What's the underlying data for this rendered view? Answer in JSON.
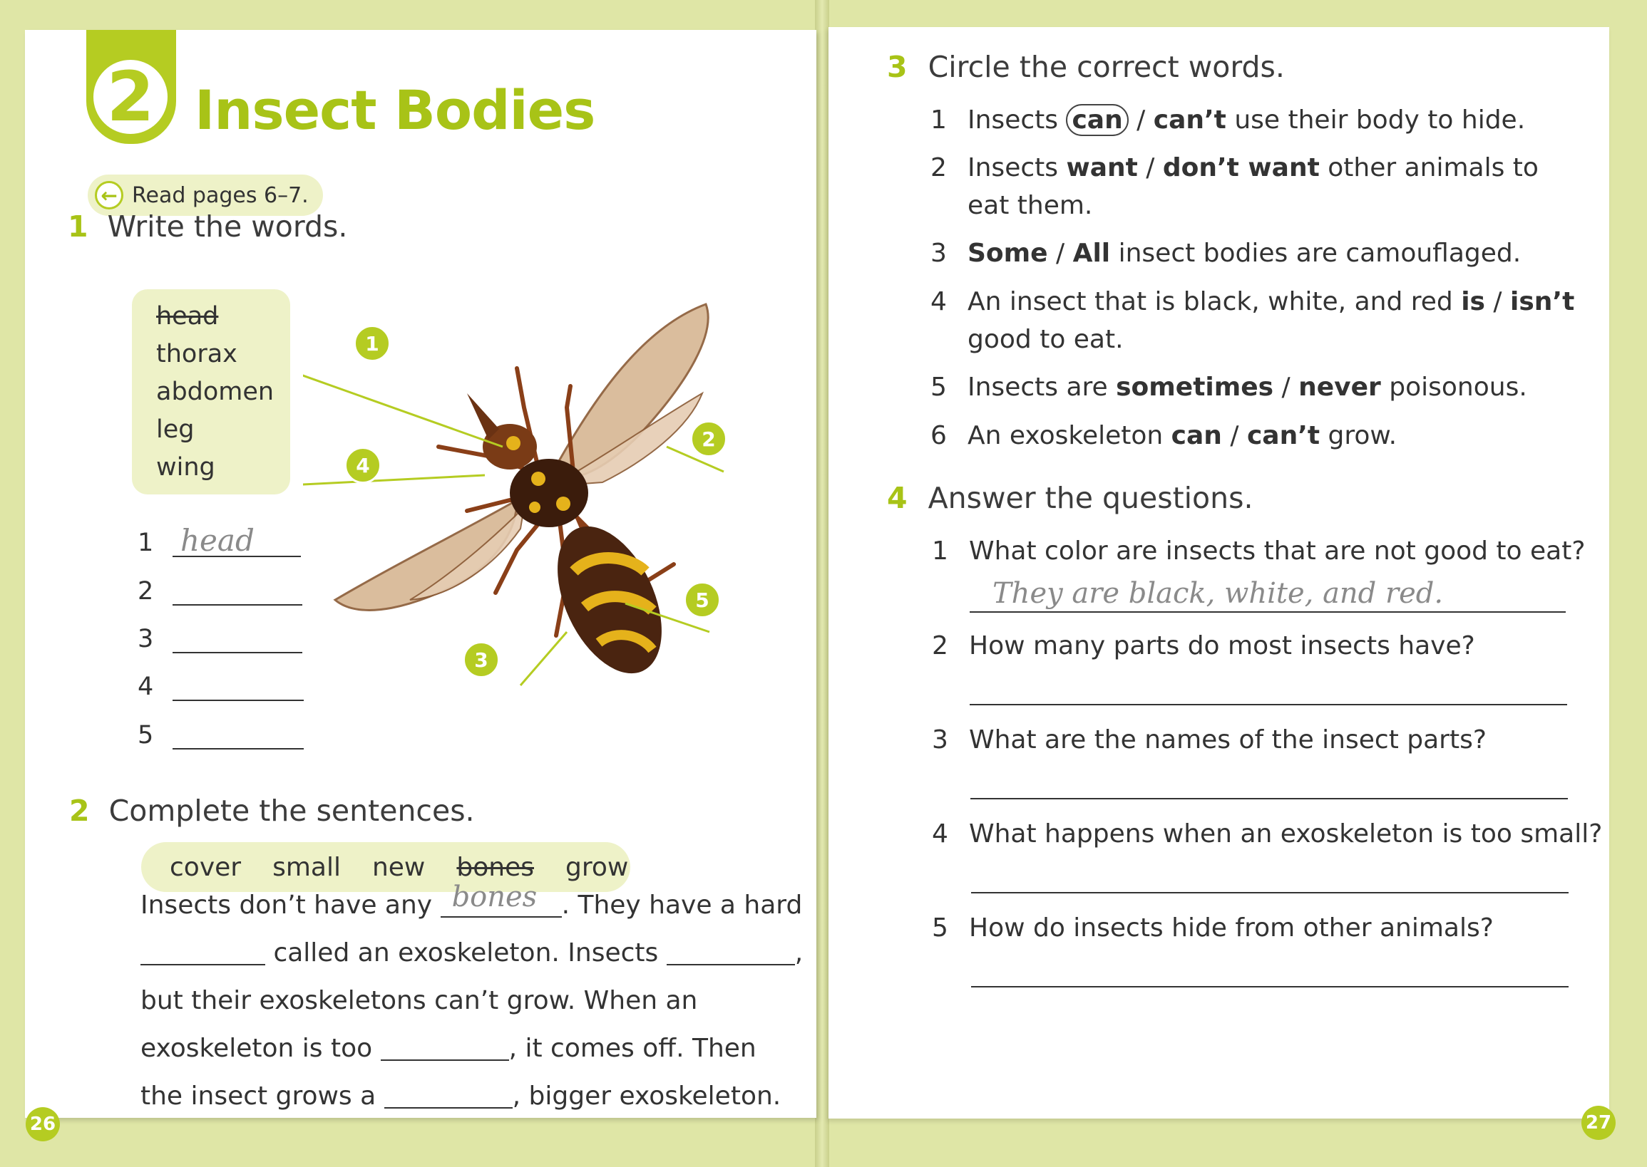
{
  "left": {
    "unit_number": "2",
    "unit_title": "Insect Bodies",
    "read_note": "Read pages 6–7.",
    "ex1": {
      "number": "1",
      "title": "Write the words.",
      "word_bank": [
        "head",
        "thorax",
        "abdomen",
        "leg",
        "wing"
      ],
      "answer_numbers": [
        "1",
        "2",
        "3",
        "4",
        "5"
      ],
      "first_answer": "head",
      "callouts": [
        "1",
        "2",
        "3",
        "4",
        "5"
      ]
    },
    "ex2": {
      "number": "2",
      "title": "Complete the sentences.",
      "word_bank": [
        "cover",
        "small",
        "new",
        "bones",
        "grow"
      ],
      "lines": {
        "l1a": "Insects don’t have any",
        "l1_answer": "bones",
        "l1b": ". They have a hard",
        "l2a": "called an exoskeleton. Insects",
        "l2b": ",",
        "l3": "but their exoskeletons can’t grow. When an",
        "l4a": "exoskeleton is too",
        "l4b": ", it comes off. Then",
        "l5a": "the insect grows a",
        "l5b": ", bigger exoskeleton."
      }
    },
    "page_number": "26"
  },
  "right": {
    "ex3": {
      "number": "3",
      "title": "Circle the correct words.",
      "items": [
        {
          "n": "1",
          "pre": "Insects ",
          "a": "can",
          "sep": " / ",
          "b": "can’t",
          "post": " use their body to hide."
        },
        {
          "n": "2",
          "pre": "Insects ",
          "a": "want",
          "sep": " / ",
          "b": "don’t want",
          "post": " other animals to",
          "cont": "eat them."
        },
        {
          "n": "3",
          "pre": "",
          "a": "Some",
          "sep": " / ",
          "b": "All",
          "post": " insect bodies are camouflaged."
        },
        {
          "n": "4",
          "pre": "An insect that is black, white, and red ",
          "a": "is",
          "sep": " / ",
          "b": "isn’t",
          "post": "",
          "cont": "good to eat."
        },
        {
          "n": "5",
          "pre": "Insects are ",
          "a": "sometimes",
          "sep": " / ",
          "b": "never",
          "post": " poisonous."
        },
        {
          "n": "6",
          "pre": "An exoskeleton ",
          "a": "can",
          "sep": " / ",
          "b": "can’t",
          "post": " grow."
        }
      ]
    },
    "ex4": {
      "number": "4",
      "title": "Answer the questions.",
      "questions": [
        {
          "n": "1",
          "text": "What color are insects that are not good to eat?",
          "answer": "They are black, white, and red."
        },
        {
          "n": "2",
          "text": "How many parts do most insects have?"
        },
        {
          "n": "3",
          "text": "What are the names of the insect parts?"
        },
        {
          "n": "4",
          "text": "What happens when an exoskeleton is too small?"
        },
        {
          "n": "5",
          "text": "How do insects hide from other animals?"
        }
      ]
    },
    "page_number": "27"
  },
  "colors": {
    "accent": "#b5cc22",
    "accent_text": "#a8c317",
    "pill_bg": "#eef2c8",
    "background": "#dfe6a6"
  }
}
